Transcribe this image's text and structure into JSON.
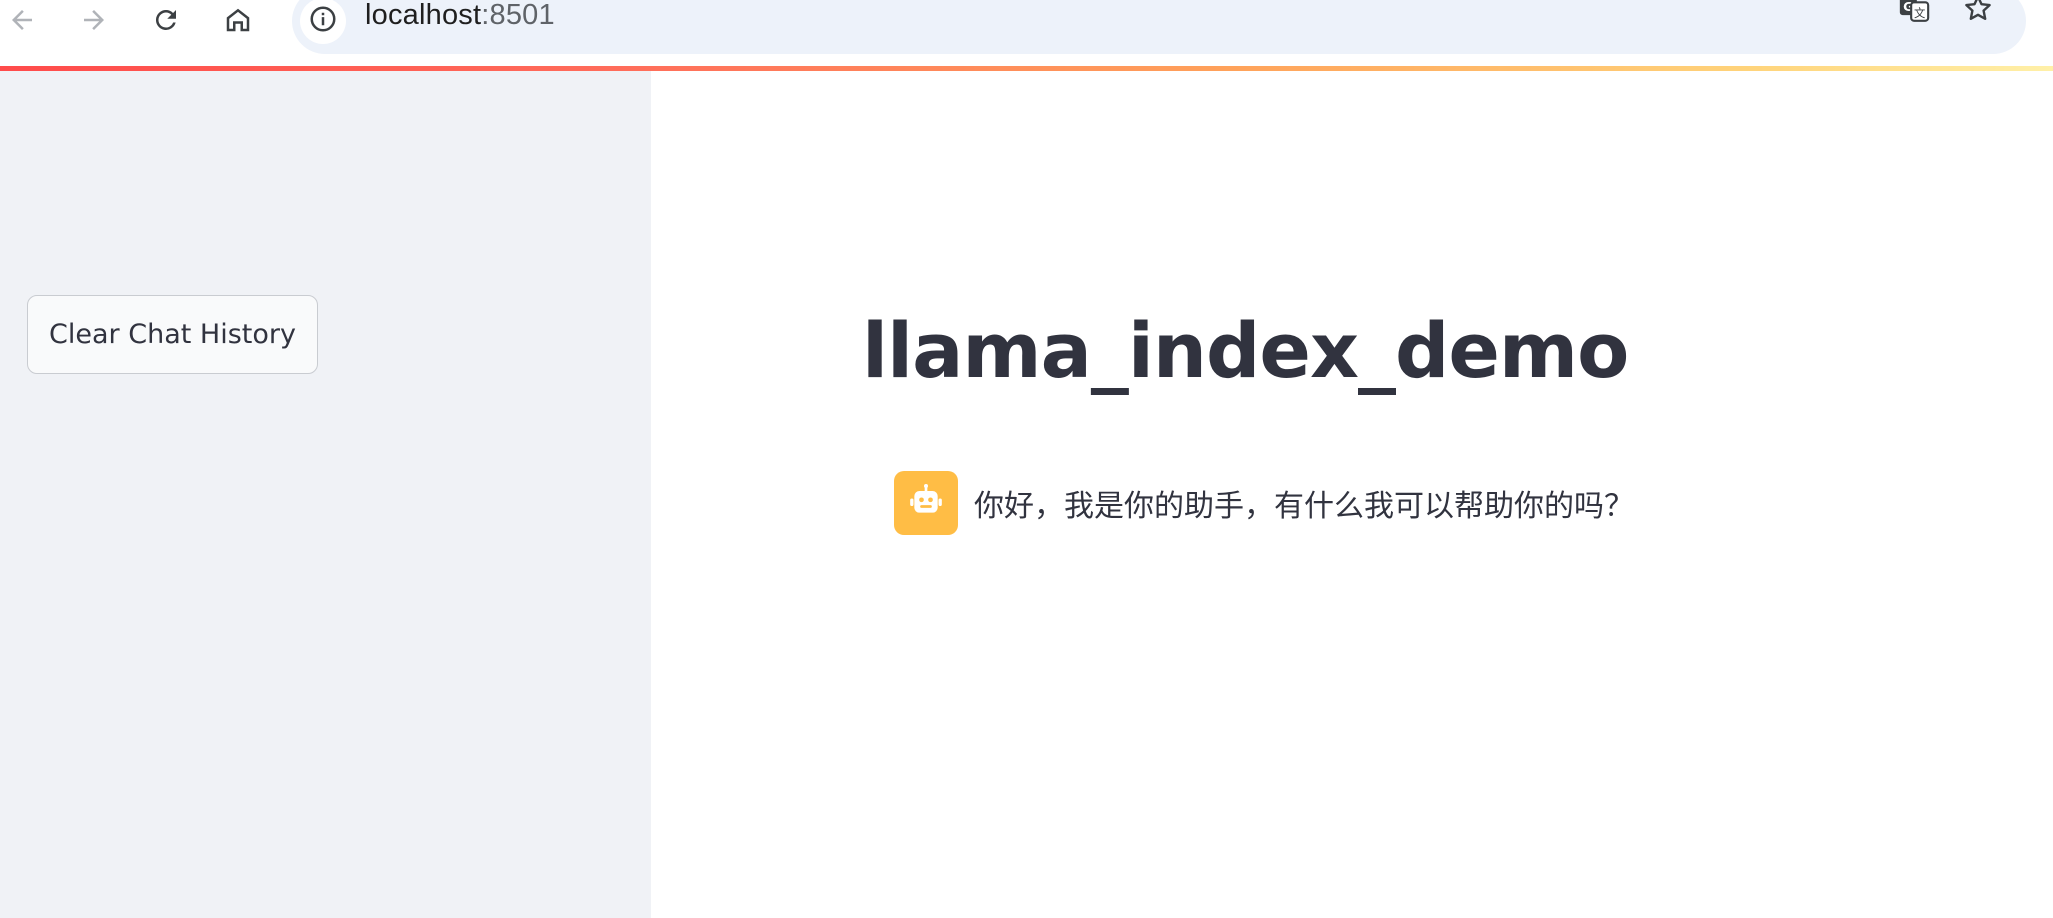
{
  "browser": {
    "url_host": "localhost",
    "url_port": ":8501",
    "icons": [
      "back-arrow-icon",
      "forward-arrow-icon",
      "reload-icon",
      "home-icon",
      "site-info-icon",
      "translate-icon",
      "bookmark-star-icon"
    ]
  },
  "sidebar": {
    "clear_button_label": "Clear Chat History"
  },
  "main": {
    "title": "llama_index_demo",
    "messages": [
      {
        "role": "assistant",
        "avatar_icon": "robot-icon",
        "text": "你好，我是你的助手，有什么我可以帮助你的吗？"
      }
    ]
  },
  "colors": {
    "sidebar_bg": "#f0f2f6",
    "text": "#31333f",
    "avatar_bg": "#ffbd45",
    "address_bar_bg": "#edf2fa"
  }
}
